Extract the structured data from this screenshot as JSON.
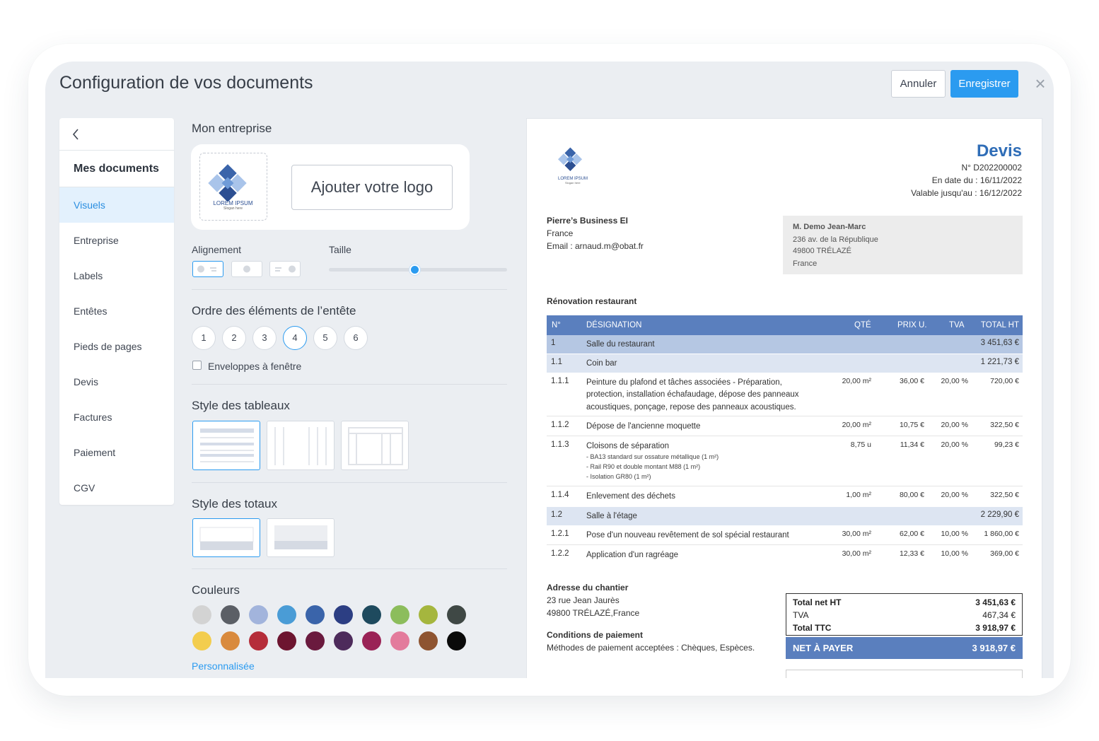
{
  "window": {
    "title": "Configuration de vos documents",
    "cancel_label": "Annuler",
    "save_label": "Enregistrer",
    "close_icon": "close-icon"
  },
  "sidebar": {
    "header": "Mes documents",
    "items": [
      {
        "label": "Visuels",
        "active": true
      },
      {
        "label": "Entreprise"
      },
      {
        "label": "Labels"
      },
      {
        "label": "Entêtes"
      },
      {
        "label": "Pieds de pages"
      },
      {
        "label": "Devis"
      },
      {
        "label": "Factures"
      },
      {
        "label": "Paiement"
      },
      {
        "label": "CGV"
      }
    ]
  },
  "settings": {
    "company_title": "Mon entreprise",
    "logo_text": "LOREM IPSUM",
    "logo_slogan": "Slogan here",
    "add_logo_label": "Ajouter votre logo",
    "alignment_label": "Alignement",
    "size_label": "Taille",
    "size_value": 0.5,
    "header_order_title": "Ordre des éléments de l’entête",
    "header_order_options": [
      "1",
      "2",
      "3",
      "4",
      "5",
      "6"
    ],
    "header_order_selected": "4",
    "window_envelope_label": "Enveloppes à fenêtre",
    "table_style_title": "Style des tableaux",
    "totals_style_title": "Style des totaux",
    "colors_title": "Couleurs",
    "colors": [
      "#d3d3d3",
      "#5b5f66",
      "#a2b4dc",
      "#4a9cd6",
      "#3a64aa",
      "#2c3e83",
      "#1e4a5e",
      "#8cbd5c",
      "#a5b63e",
      "#3f4845",
      "#f3cd4e",
      "#d98a3d",
      "#b52d3a",
      "#6d1530",
      "#6a1a3e",
      "#4d2b5b",
      "#9a2356",
      "#e37b9c",
      "#8e5431",
      "#0a0a0a"
    ],
    "custom_link": "Personnalisée"
  },
  "doc": {
    "title": "Devis",
    "number": "N° D202200002",
    "date": "En date du : 16/11/2022",
    "valid_until": "Valable jusqu'au : 16/12/2022",
    "logo_text": "LOREM IPSUM",
    "logo_slogan": "Slogan here",
    "company": {
      "name": "Pierre’s Business EI",
      "country": "France",
      "email": "Email : arnaud.m@obat.fr"
    },
    "client": {
      "name": "M. Demo Jean-Marc",
      "street": "236 av. de la République",
      "city": "49800 TRÉLAZÉ",
      "country": "France"
    },
    "project": "Rénovation restaurant",
    "columns": [
      "N°",
      "DÉSIGNATION",
      "QTÉ",
      "PRIX U.",
      "TVA",
      "TOTAL HT"
    ],
    "rows": [
      {
        "num": "1",
        "desc": "Salle du restaurant",
        "total": "3 451,63 €"
      },
      {
        "num": "1.1",
        "desc": "Coin bar",
        "total": "1 221,73 €"
      },
      {
        "num": "1.1.1",
        "desc1": "Peinture du plafond et tâches associées - Préparation,",
        "desc2": "protection, installation échafaudage, dépose des panneaux",
        "desc3": "acoustiques, ponçage, repose des panneaux acoustiques.",
        "qty": "20,00 m²",
        "pu": "36,00 €",
        "tva": "20,00 %",
        "total": "720,00 €"
      },
      {
        "num": "1.1.2",
        "desc": "Dépose de l'ancienne moquette",
        "qty": "20,00 m²",
        "pu": "10,75 €",
        "tva": "20,00 %",
        "total": "322,50 €"
      },
      {
        "num": "1.1.3",
        "desc": "Cloisons de séparation",
        "sub1": "- BA13 standard sur ossature métallique (1 m²)",
        "sub2": "- Rail R90 et double montant M88 (1 m²)",
        "sub3": "- Isolation GR80 (1 m²)",
        "qty": "8,75 u",
        "pu": "11,34 €",
        "tva": "20,00 %",
        "total": "99,23 €"
      },
      {
        "num": "1.1.4",
        "desc": "Enlevement des déchets",
        "qty": "1,00 m²",
        "pu": "80,00 €",
        "tva": "20,00 %",
        "total": "322,50 €"
      },
      {
        "num": "1.2",
        "desc": "Salle à l'étage",
        "total": "2 229,90 €"
      },
      {
        "num": "1.2.1",
        "desc": "Pose d'un nouveau revêtement de sol spécial restaurant",
        "qty": "30,00 m²",
        "pu": "62,00 €",
        "tva": "10,00 %",
        "total": "1 860,00 €"
      },
      {
        "num": "1.2.2",
        "desc": "Application d'un ragréage",
        "qty": "30,00 m²",
        "pu": "12,33 €",
        "tva": "10,00 %",
        "total": "369,00 €"
      }
    ],
    "site_address_title": "Adresse du chantier",
    "site_street": "23 rue Jean Jaurès",
    "site_city": "49800 TRÉLAZÉ,France",
    "payment_title": "Conditions de paiement",
    "payment_methods": "Méthodes de paiement acceptées : Chèques, Espèces.",
    "totals": {
      "net_ht_label": "Total net HT",
      "net_ht": "3 451,63 €",
      "tva_label": "TVA",
      "tva": "467,34 €",
      "ttc_label": "Total TTC",
      "ttc": "3 918,97 €",
      "net_pay_label": "NET À PAYER",
      "net_pay": "3 918,97 €"
    }
  }
}
